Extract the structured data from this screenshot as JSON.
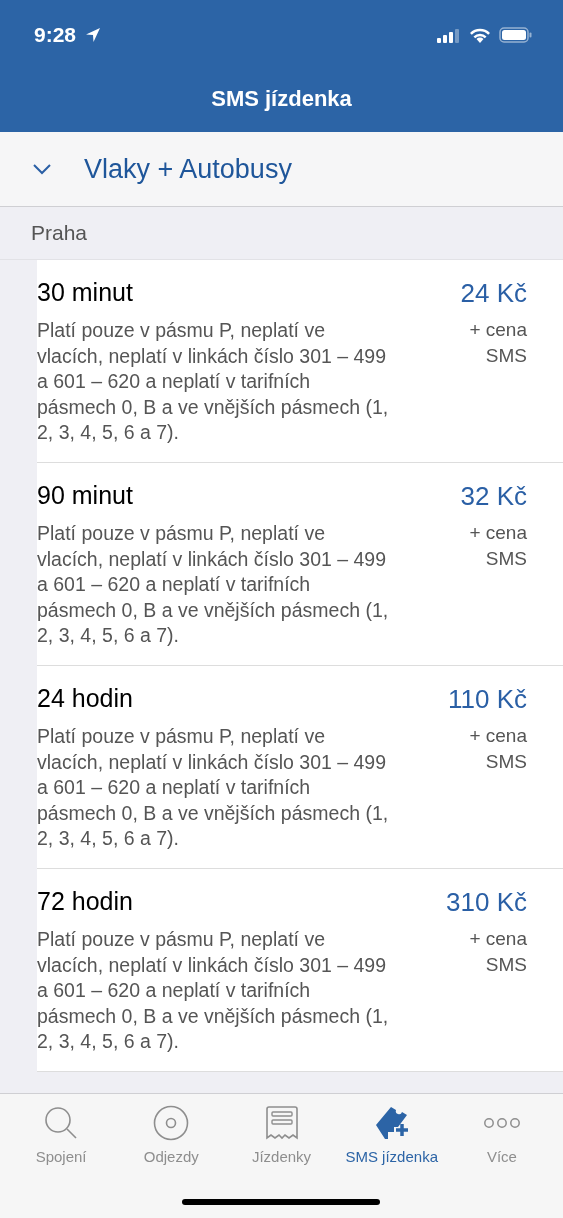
{
  "status_bar": {
    "time": "9:28"
  },
  "nav": {
    "title": "SMS jízdenka"
  },
  "selector": {
    "label": "Vlaky + Autobusy",
    "expanded": true
  },
  "sections": [
    {
      "title": "Praha",
      "tickets": [
        {
          "name": "30 minut",
          "price": "24 Kč",
          "price_note": "+ cena SMS",
          "description": "Platí pouze v pásmu P, neplatí ve vlacích, neplatí v linkách číslo 301 – 499 a 601 – 620 a neplatí v tarifních pásmech 0, B a ve vnějších pásmech (1, 2, 3, 4, 5, 6 a 7)."
        },
        {
          "name": "90 minut",
          "price": "32 Kč",
          "price_note": "+ cena SMS",
          "description": "Platí pouze v pásmu P, neplatí ve vlacích, neplatí v linkách číslo 301 – 499 a 601 – 620 a neplatí v tarifních pásmech 0, B a ve vnějších pásmech (1, 2, 3, 4, 5, 6 a 7)."
        },
        {
          "name": "24 hodin",
          "price": "110 Kč",
          "price_note": "+ cena SMS",
          "description": "Platí pouze v pásmu P, neplatí ve vlacích, neplatí v linkách číslo 301 – 499 a 601 – 620 a neplatí v tarifních pásmech 0, B a ve vnějších pásmech (1, 2, 3, 4, 5, 6 a 7)."
        },
        {
          "name": "72 hodin",
          "price": "310 Kč",
          "price_note": "+ cena SMS",
          "description": "Platí pouze v pásmu P, neplatí ve vlacích, neplatí v linkách číslo 301 – 499 a 601 – 620 a neplatí v tarifních pásmech 0, B a ve vnějších pásmech (1, 2, 3, 4, 5, 6 a 7)."
        }
      ]
    }
  ],
  "tab_bar": [
    {
      "label": "Spojení",
      "kind": "search",
      "selected": false
    },
    {
      "label": "Odjezdy",
      "kind": "departures",
      "selected": false
    },
    {
      "label": "Jízdenky",
      "kind": "tickets",
      "selected": false
    },
    {
      "label": "SMS jízdenka",
      "kind": "sms",
      "selected": true
    },
    {
      "label": "Více",
      "kind": "more",
      "selected": false
    }
  ]
}
